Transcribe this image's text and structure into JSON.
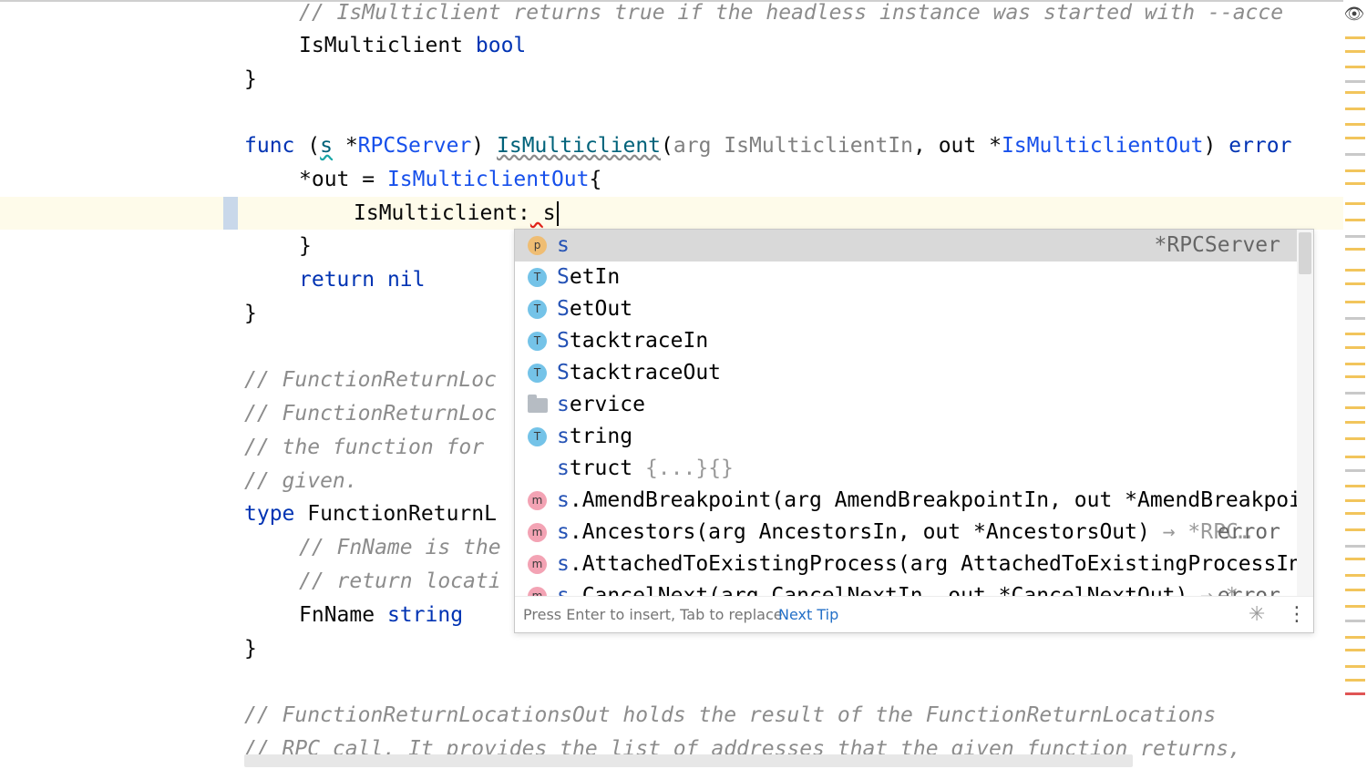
{
  "code": {
    "line1_comment": "// IsMulticlient returns true if the headless instance was started with --acce",
    "line2_field": "IsMulticlient",
    "line2_type": "bool",
    "brace": "}",
    "func_kw": "func",
    "paren_open": "(",
    "recv_name": "s",
    "star": " *",
    "recv_type": "RPCServer",
    "paren_close": ")",
    "func_name": "IsMulticlient",
    "arg_kw": "arg",
    "arg_type": "IsMulticlientIn",
    "out_kw": ", out *",
    "out_type": "IsMulticlientOut",
    "ret_type": "error",
    "assign_lhs": "*out = ",
    "assign_type": "IsMulticlientOut",
    "assign_brace": "{",
    "field_key": "IsMulticlient:",
    "field_val": "s",
    "return_kw": "return",
    "return_val": "nil",
    "c_frl1": "// FunctionReturnLoc",
    "c_frl2": "// FunctionReturnLoc",
    "c_frl3": "// the function for",
    "c_frl4": "// given.",
    "type_kw": "type",
    "type_name": "FunctionReturnL",
    "c_fn1": "// FnName is the",
    "c_fn2": "// return locati",
    "fnname_field": "FnName",
    "fnname_type": "string",
    "c_out1": "// FunctionReturnLocationsOut holds the result of the FunctionReturnLocations",
    "c_out2": "// RPC call. It provides the list of addresses that the given function returns,"
  },
  "completion": {
    "items": [
      {
        "icon": "p",
        "match": "s",
        "rest": "",
        "type": "*RPCServer",
        "selected": true
      },
      {
        "icon": "T",
        "match": "S",
        "rest": "etIn",
        "type": ""
      },
      {
        "icon": "T",
        "match": "S",
        "rest": "etOut",
        "type": ""
      },
      {
        "icon": "T",
        "match": "S",
        "rest": "tacktraceIn",
        "type": ""
      },
      {
        "icon": "T",
        "match": "S",
        "rest": "tacktraceOut",
        "type": ""
      },
      {
        "icon": "folder",
        "match": "s",
        "rest": "ervice",
        "type": ""
      },
      {
        "icon": "T",
        "match": "s",
        "rest": "tring",
        "type": ""
      },
      {
        "icon": "none",
        "match": "s",
        "rest": "truct",
        "tail": " {...}{}",
        "type": ""
      },
      {
        "icon": "m",
        "match": "s",
        "rest": ".AmendBreakpoint(arg AmendBreakpointIn, out *AmendBreakpoin…",
        "type": ""
      },
      {
        "icon": "m",
        "match": "s",
        "rest": ".Ancestors(arg AncestorsIn, out *AncestorsOut)",
        "tail": " → *RPC…",
        "type": "error"
      },
      {
        "icon": "m",
        "match": "s",
        "rest": ".AttachedToExistingProcess(arg AttachedToExistingProcessIn,…",
        "type": ""
      },
      {
        "icon": "m",
        "match": "s",
        "rest": ".CancelNext(arg CancelNextIn, out *CancelNextOut)",
        "tail": " → *…",
        "type": "error"
      }
    ],
    "footer_hint": "Press Enter to insert, Tab to replace",
    "footer_link": "Next Tip",
    "spinner_icon": "loading-spinner-icon",
    "more_icon": "vertical-ellipsis-icon"
  },
  "marker_colors": {
    "warning": "#f2c55c",
    "error": "#e05555",
    "info": "#c9c9c9"
  }
}
